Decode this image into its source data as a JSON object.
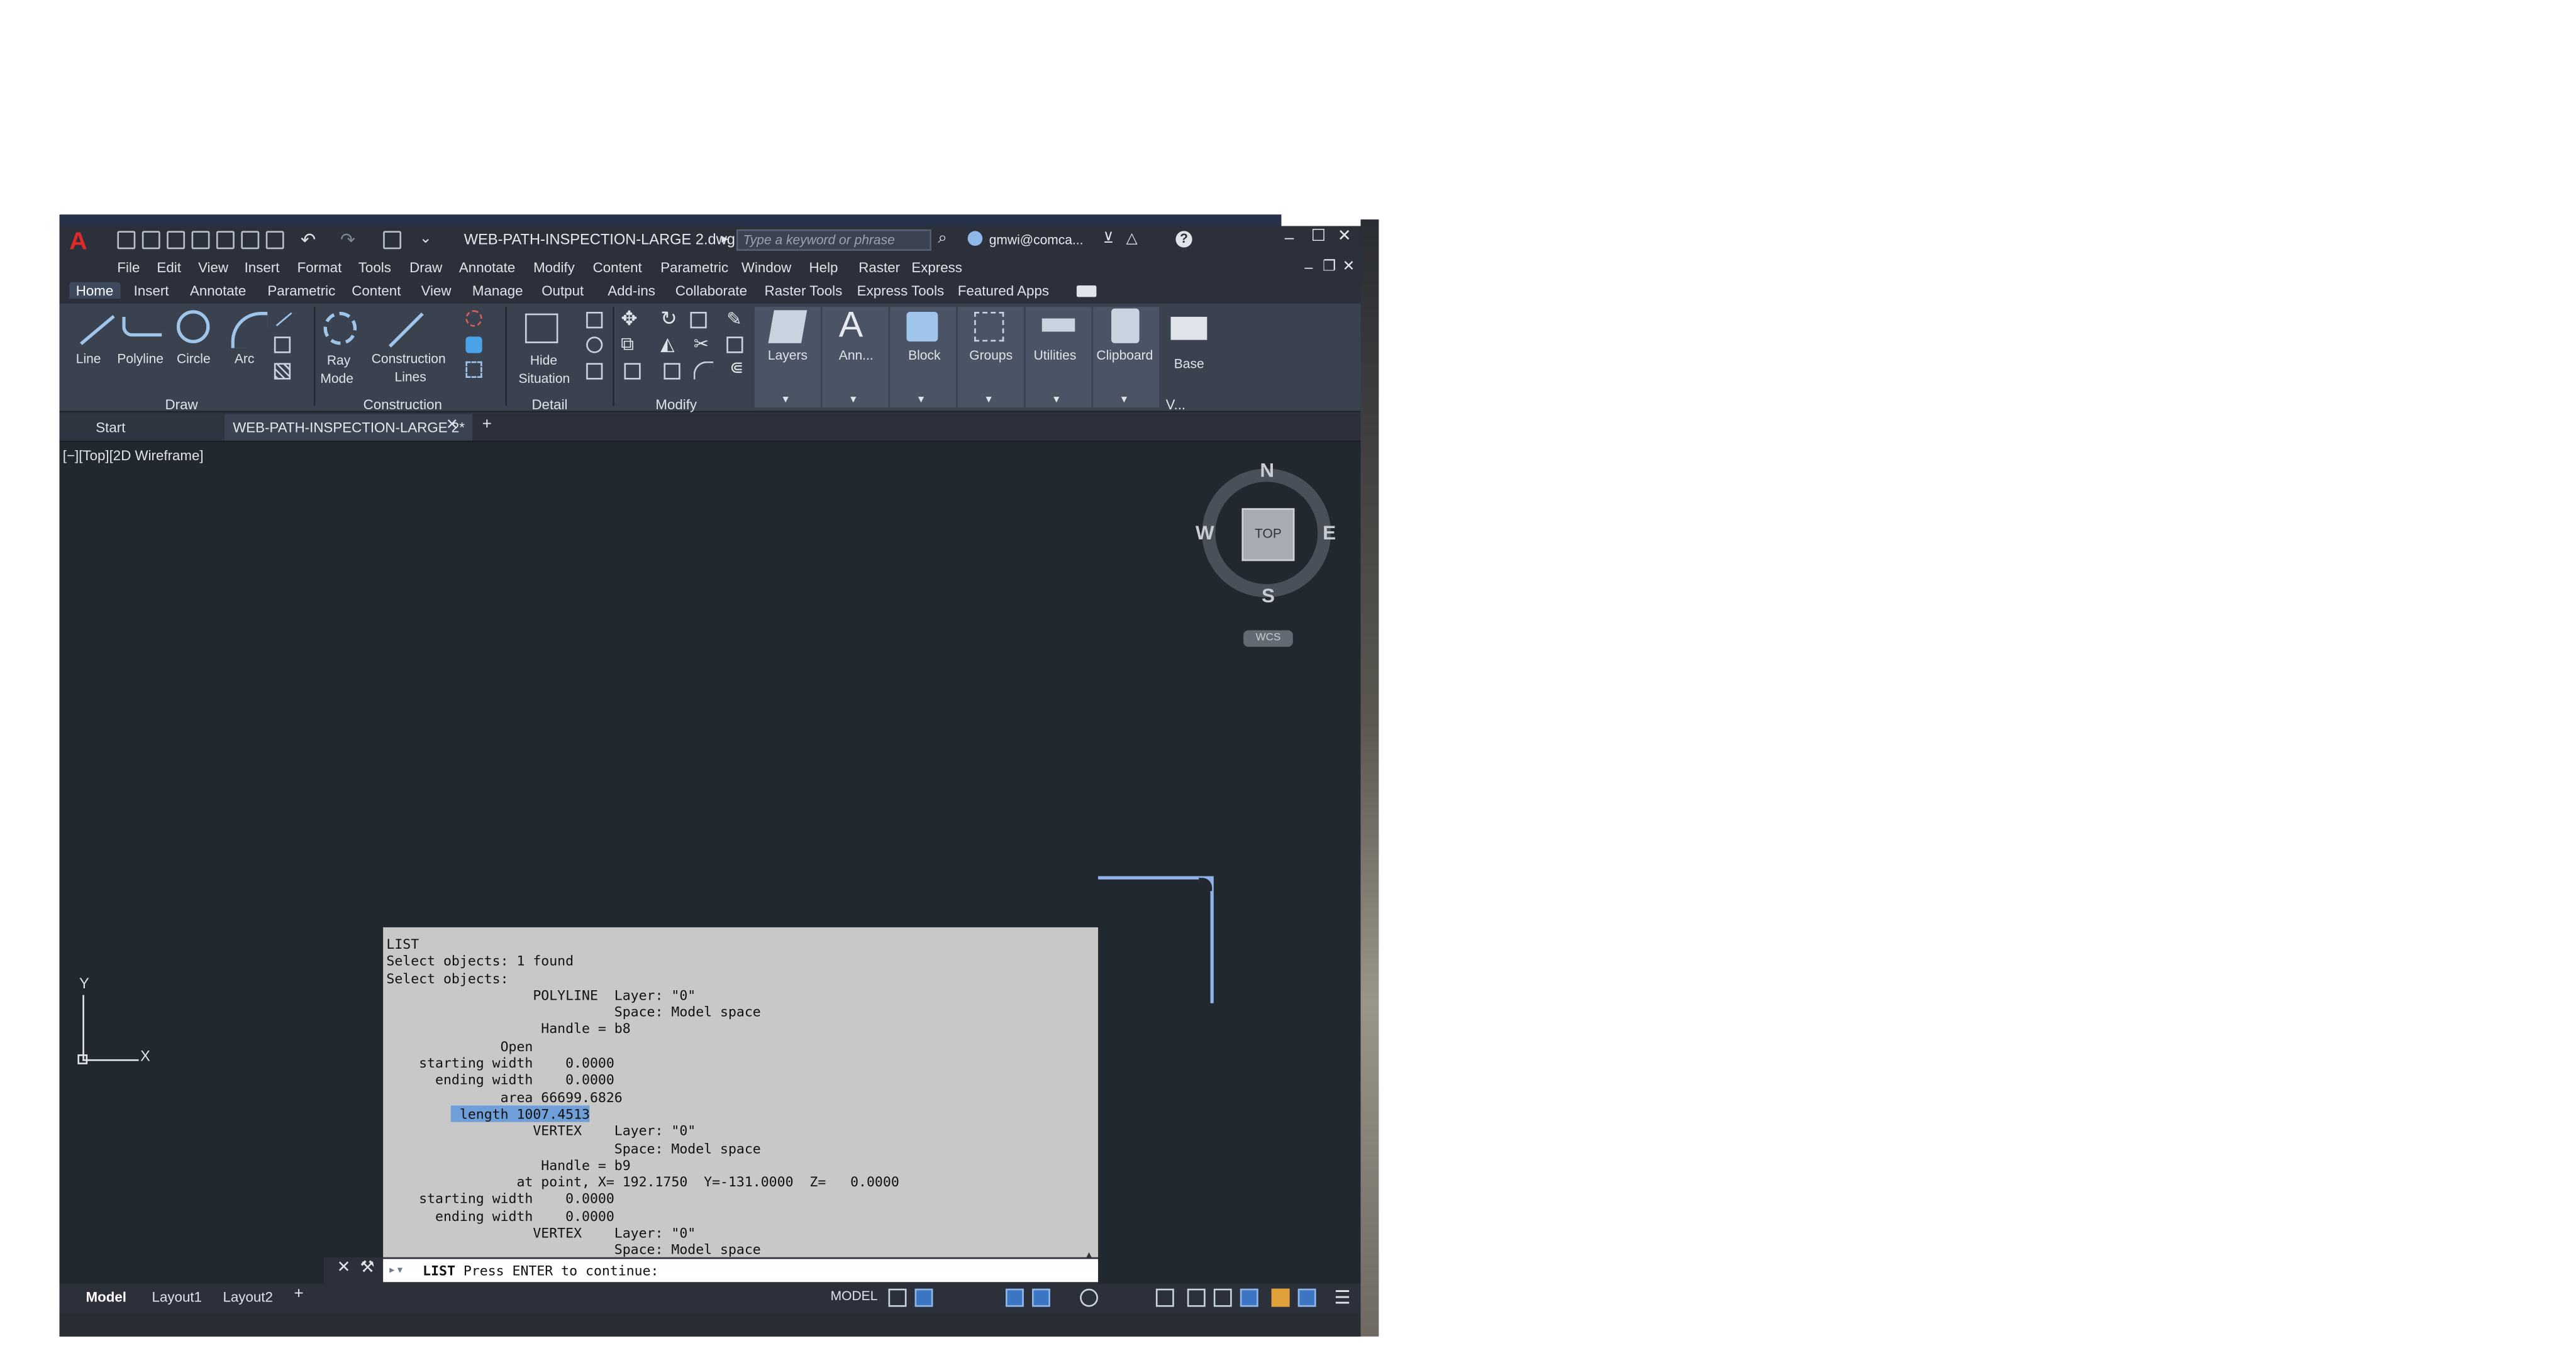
{
  "window": {
    "title": "WEB-PATH-INSPECTION-LARGE 2.dwg",
    "search_placeholder": "Type a keyword or phrase",
    "user": "gmwi@comca..."
  },
  "menu": [
    "File",
    "Edit",
    "View",
    "Insert",
    "Format",
    "Tools",
    "Draw",
    "Annotate",
    "Modify",
    "Content",
    "Parametric",
    "Window",
    "Help",
    "Raster",
    "Express"
  ],
  "ribbon_tabs": [
    "Home",
    "Insert",
    "Annotate",
    "Parametric",
    "Content",
    "View",
    "Manage",
    "Output",
    "Add-ins",
    "Collaborate",
    "Raster Tools",
    "Express Tools",
    "Featured Apps"
  ],
  "ribbon": {
    "draw_tools": [
      "Line",
      "Polyline",
      "Circle",
      "Arc"
    ],
    "ray_mode": [
      "Ray",
      "Mode"
    ],
    "construction_lines": [
      "Construction",
      "Lines"
    ],
    "hide_situation": [
      "Hide",
      "Situation"
    ],
    "big_buttons": [
      "Layers",
      "Ann...",
      "Block",
      "Groups",
      "Utilities",
      "Clipboard",
      "Base"
    ],
    "panels": [
      "Draw",
      "Construction",
      "Detail",
      "Modify",
      "V..."
    ]
  },
  "file_tabs": {
    "start": "Start",
    "doc": "WEB-PATH-INSPECTION-LARGE 2*"
  },
  "viewport": {
    "label": "[−][Top][2D Wireframe]",
    "compass": {
      "n": "N",
      "s": "S",
      "e": "E",
      "w": "W",
      "top": "TOP",
      "wcs": "WCS"
    },
    "ucs": {
      "x": "X",
      "y": "Y"
    }
  },
  "text_window": {
    "lines_before": "LIST\nSelect objects: 1 found\nSelect objects:\n                  POLYLINE  Layer: \"0\"\n                            Space: Model space\n                   Handle = b8\n              Open\n    starting width    0.0000\n      ending width    0.0000\n              area 66699.6826",
    "highlight_prefix": "        ",
    "highlight": " length 1007.4513",
    "lines_after": "                  VERTEX    Layer: \"0\"\n                            Space: Model space\n                   Handle = b9\n                at point, X= 192.1750  Y=-131.0000  Z=   0.0000\n    starting width    0.0000\n      ending width    0.0000\n                  VERTEX    Layer: \"0\"\n                            Space: Model space"
  },
  "command": {
    "keyword": "LIST",
    "prompt": " Press ENTER to continue:"
  },
  "layout_tabs": [
    "Model",
    "Layout1",
    "Layout2"
  ],
  "status": {
    "model": "MODEL"
  }
}
